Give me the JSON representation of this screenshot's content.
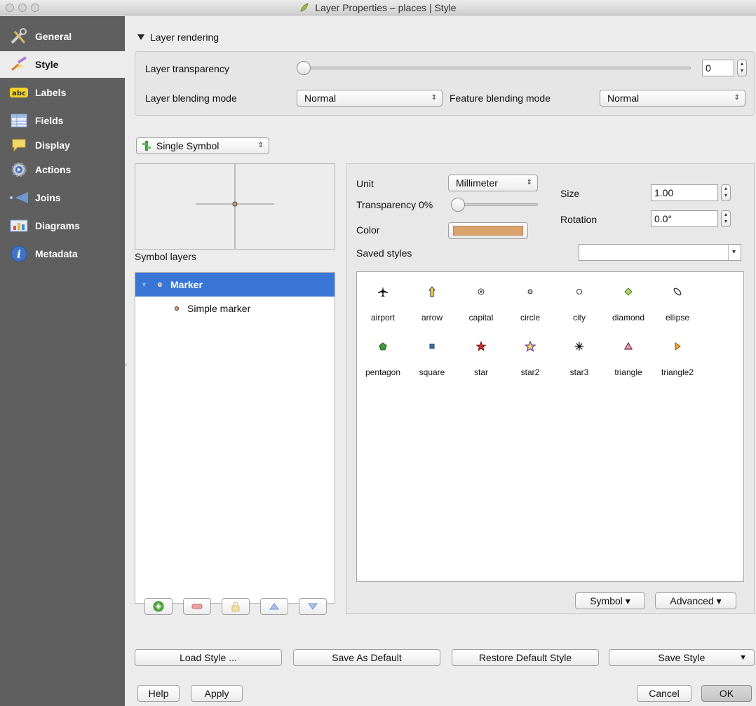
{
  "window": {
    "title": "Layer Properties – places | Style"
  },
  "sidebar": {
    "items": [
      {
        "label": "General",
        "icon": "tools-icon"
      },
      {
        "label": "Style",
        "icon": "brush-icon"
      },
      {
        "label": "Labels",
        "icon": "labels-abc-icon"
      },
      {
        "label": "Fields",
        "icon": "table-icon"
      },
      {
        "label": "Display",
        "icon": "speech-bubble-icon"
      },
      {
        "label": "Actions",
        "icon": "gear-icon"
      },
      {
        "label": "Joins",
        "icon": "join-arrow-icon"
      },
      {
        "label": "Diagrams",
        "icon": "diagram-icon"
      },
      {
        "label": "Metadata",
        "icon": "info-icon"
      }
    ],
    "active": "Style"
  },
  "rendering": {
    "header": "Layer rendering",
    "transparency_label": "Layer transparency",
    "transparency_value": "0",
    "layer_blend_label": "Layer blending mode",
    "layer_blend_value": "Normal",
    "feature_blend_label": "Feature blending mode",
    "feature_blend_value": "Normal"
  },
  "renderer": {
    "type": "Single Symbol"
  },
  "symbol_layers": {
    "label": "Symbol layers",
    "items": [
      {
        "label": "Marker",
        "selected": true
      },
      {
        "label": "Simple marker",
        "selected": false
      }
    ]
  },
  "properties": {
    "unit_label": "Unit",
    "unit_value": "Millimeter",
    "transparency_label": "Transparency 0%",
    "color_label": "Color",
    "color_value": "#d9a36b",
    "size_label": "Size",
    "size_value": "1.00",
    "rotation_label": "Rotation",
    "rotation_value": "0.0°",
    "saved_styles_label": "Saved styles",
    "saved_styles_value": ""
  },
  "gallery": {
    "symbols": [
      {
        "label": "airport",
        "icon": "airport-icon"
      },
      {
        "label": "arrow",
        "icon": "arrow-icon"
      },
      {
        "label": "capital",
        "icon": "capital-icon"
      },
      {
        "label": "circle",
        "icon": "circle-icon"
      },
      {
        "label": "city",
        "icon": "city-icon"
      },
      {
        "label": "diamond",
        "icon": "diamond-icon"
      },
      {
        "label": "ellipse",
        "icon": "ellipse-icon"
      },
      {
        "label": "pentagon",
        "icon": "pentagon-icon"
      },
      {
        "label": "square",
        "icon": "square-icon"
      },
      {
        "label": "star",
        "icon": "star-icon"
      },
      {
        "label": "star2",
        "icon": "star2-icon"
      },
      {
        "label": "star3",
        "icon": "star3-icon"
      },
      {
        "label": "triangle",
        "icon": "triangle-icon"
      },
      {
        "label": "triangle2",
        "icon": "triangle2-icon"
      }
    ],
    "symbol_button": "Symbol ▾",
    "advanced_button": "Advanced ▾"
  },
  "footer": {
    "load_style": "Load Style ...",
    "save_default": "Save As Default",
    "restore_default": "Restore Default Style",
    "save_style": "Save Style",
    "help": "Help",
    "apply": "Apply",
    "cancel": "Cancel",
    "ok": "OK"
  }
}
